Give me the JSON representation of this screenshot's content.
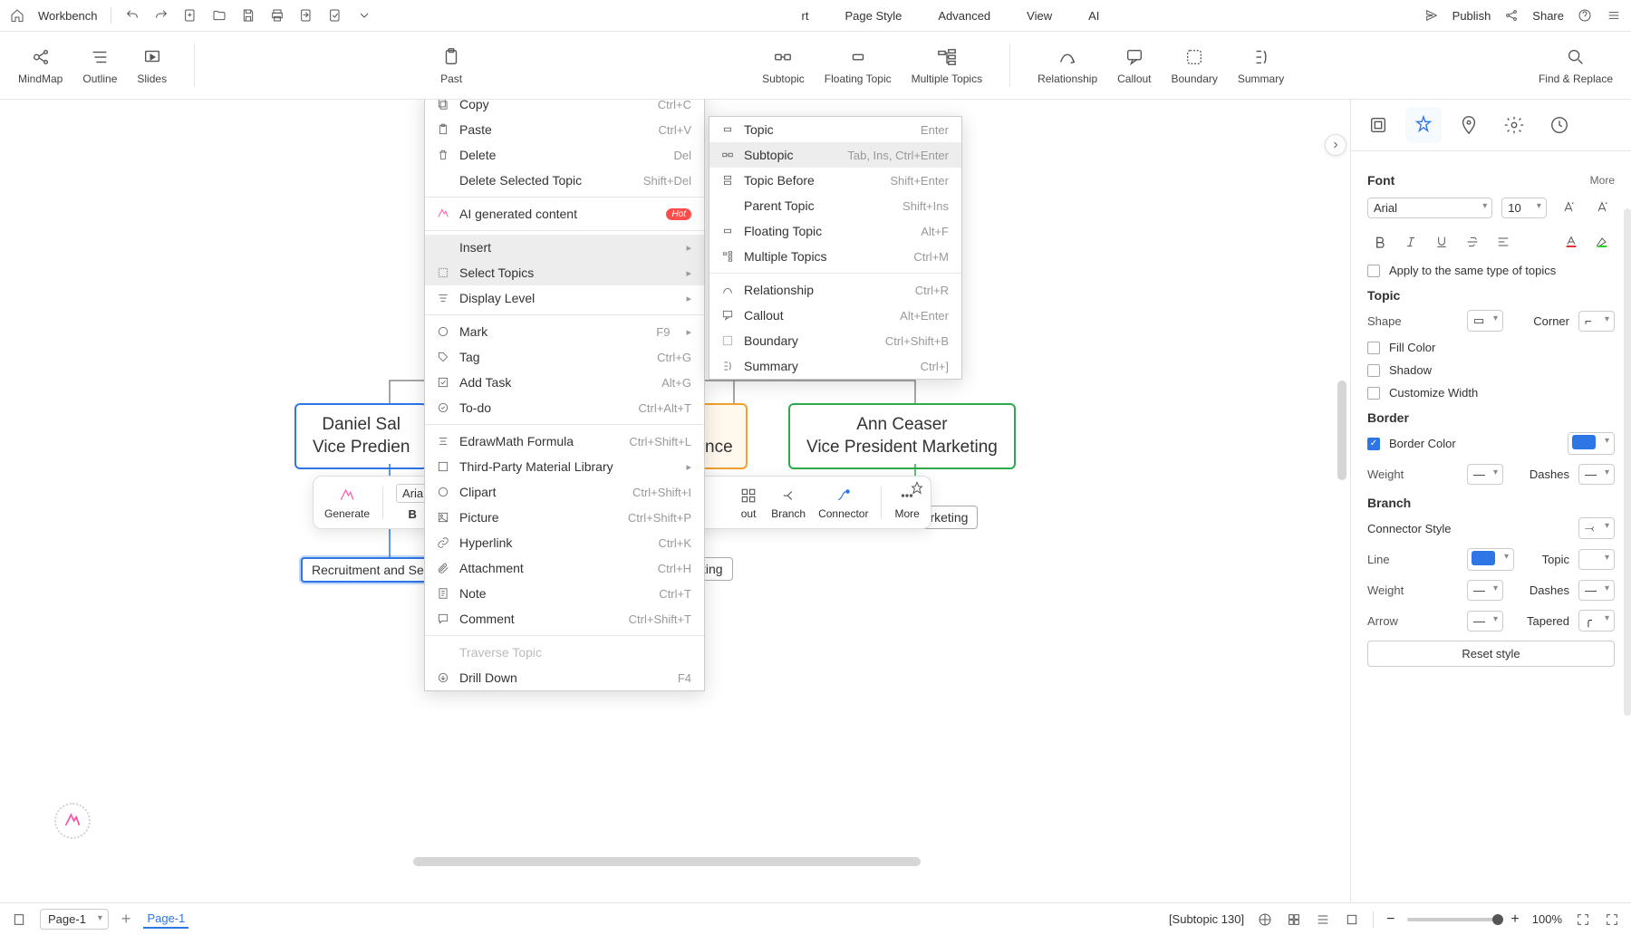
{
  "topbar": {
    "workbench": "Workbench",
    "menus": [
      "rt",
      "Page Style",
      "Advanced",
      "View",
      "AI"
    ],
    "publish": "Publish",
    "share": "Share"
  },
  "viewtabs": {
    "mindmap": "MindMap",
    "outline": "Outline",
    "slides": "Slides"
  },
  "toolbar": {
    "paste": "Past",
    "subtopic": "Subtopic",
    "floating": "Floating Topic",
    "multiple": "Multiple Topics",
    "relationship": "Relationship",
    "callout": "Callout",
    "boundary": "Boundary",
    "summary": "Summary",
    "find": "Find & Replace"
  },
  "canvas": {
    "box1_l1": "Daniel Sal",
    "box1_l2": "Vice Predien",
    "box2_tail": "nce",
    "box3_l1": "Ann Ceaser",
    "box3_l2": "Vice President Marketing",
    "sub1": "Recruitment and Se",
    "sub2": "ting",
    "sub3": "Marketing"
  },
  "float": {
    "font": "Arial",
    "generate": "Generate",
    "bold": "B",
    "italic": "I",
    "layout_tail": "out",
    "branch": "Branch",
    "connector": "Connector",
    "more": "More"
  },
  "ctx": {
    "copy": "Copy",
    "copy_sc": "Ctrl+C",
    "paste": "Paste",
    "paste_sc": "Ctrl+V",
    "delete": "Delete",
    "delete_sc": "Del",
    "del_sel": "Delete Selected Topic",
    "del_sel_sc": "Shift+Del",
    "ai": "AI generated content",
    "hot": "Hot",
    "insert": "Insert",
    "select_topics": "Select Topics",
    "display_level": "Display Level",
    "mark": "Mark",
    "mark_sc": "F9",
    "tag": "Tag",
    "tag_sc": "Ctrl+G",
    "add_task": "Add Task",
    "add_task_sc": "Alt+G",
    "todo": "To-do",
    "todo_sc": "Ctrl+Alt+T",
    "edraw": "EdrawMath Formula",
    "edraw_sc": "Ctrl+Shift+L",
    "third": "Third-Party Material Library",
    "clipart": "Clipart",
    "clipart_sc": "Ctrl+Shift+I",
    "picture": "Picture",
    "picture_sc": "Ctrl+Shift+P",
    "hyperlink": "Hyperlink",
    "hyperlink_sc": "Ctrl+K",
    "attachment": "Attachment",
    "attachment_sc": "Ctrl+H",
    "note": "Note",
    "note_sc": "Ctrl+T",
    "comment": "Comment",
    "comment_sc": "Ctrl+Shift+T",
    "traverse": "Traverse Topic",
    "drill": "Drill Down",
    "drill_sc": "F4"
  },
  "sub": {
    "topic": "Topic",
    "topic_sc": "Enter",
    "subtopic": "Subtopic",
    "subtopic_sc": "Tab, Ins, Ctrl+Enter",
    "before": "Topic Before",
    "before_sc": "Shift+Enter",
    "parent": "Parent Topic",
    "parent_sc": "Shift+Ins",
    "floating": "Floating Topic",
    "floating_sc": "Alt+F",
    "multiple": "Multiple Topics",
    "multiple_sc": "Ctrl+M",
    "relationship": "Relationship",
    "relationship_sc": "Ctrl+R",
    "callout": "Callout",
    "callout_sc": "Alt+Enter",
    "boundary": "Boundary",
    "boundary_sc": "Ctrl+Shift+B",
    "summary": "Summary",
    "summary_sc": "Ctrl+]"
  },
  "panel": {
    "font_h": "Font",
    "more": "More",
    "font_family": "Arial",
    "font_size": "10",
    "apply_same": "Apply to the same type of topics",
    "topic_h": "Topic",
    "shape": "Shape",
    "corner": "Corner",
    "fill": "Fill Color",
    "shadow": "Shadow",
    "custom_w": "Customize Width",
    "border_h": "Border",
    "border_color": "Border Color",
    "weight": "Weight",
    "dashes": "Dashes",
    "branch_h": "Branch",
    "connector_style": "Connector Style",
    "line": "Line",
    "topic_lbl": "Topic",
    "arrow": "Arrow",
    "tapered": "Tapered",
    "reset": "Reset style",
    "border_swatch": "#2e75e6",
    "line_swatch": "#2e75e6"
  },
  "bottom": {
    "page_sel": "Page-1",
    "page_tab": "Page-1",
    "status": "[Subtopic 130]",
    "zoom": "100%"
  }
}
